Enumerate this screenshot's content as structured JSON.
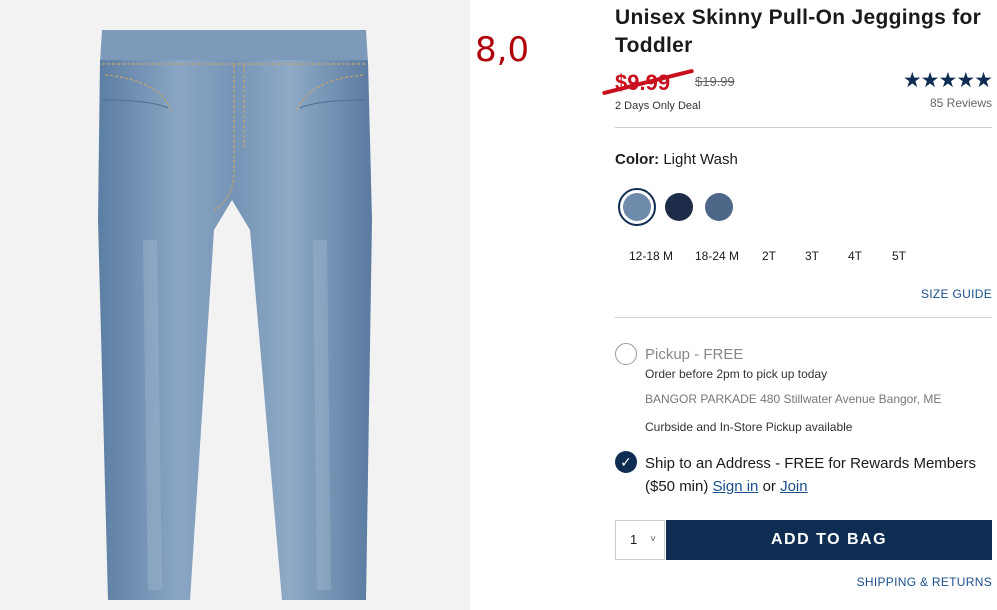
{
  "product": {
    "title": "Unisex Skinny Pull-On Jeggings for Toddler",
    "sale_price": "$9.99",
    "original_price": "$19.99",
    "deal_text": "2 Days Only Deal",
    "stars": "★★★★★",
    "rating_value": 5,
    "reviews": "85 Reviews"
  },
  "annotation": "8,0",
  "color": {
    "label": "Color:",
    "value": "Light Wash",
    "swatches": [
      {
        "name": "Light Wash",
        "hex": "#6e8bab",
        "selected": true
      },
      {
        "name": "Dark Wash",
        "hex": "#1d2c48",
        "selected": false
      },
      {
        "name": "Medium Wash",
        "hex": "#4e6688",
        "selected": false
      }
    ]
  },
  "sizes": [
    "12-18 M",
    "18-24 M",
    "2T",
    "3T",
    "4T",
    "5T"
  ],
  "size_guide": "SIZE GUIDE",
  "pickup": {
    "label": "Pickup - FREE",
    "subtext": "Order before 2pm to pick up today",
    "store": "BANGOR PARKADE 480 Stillwater Avenue  Bangor, ME",
    "curbside": "Curbside and In-Store Pickup available"
  },
  "shipping": {
    "label_prefix": "Ship to an Address - FREE for Rewards Members ($50 min) ",
    "sign_in": "Sign in",
    "or": " or ",
    "join": "Join"
  },
  "quantity": {
    "value": "1",
    "chevron": "˅"
  },
  "add_to_bag": "ADD TO BAG",
  "shipping_returns": "SHIPPING & RETURNS",
  "check_icon": "✓",
  "colors": {
    "brand_navy": "#0f2d52",
    "sale_red": "#c8101e",
    "link_blue": "#1a4f8c"
  }
}
